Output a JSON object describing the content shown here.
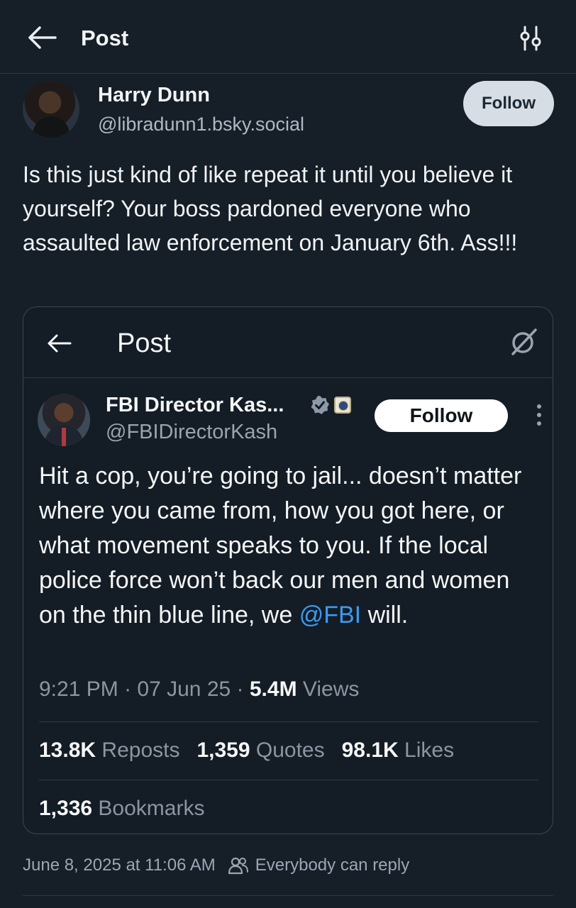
{
  "header": {
    "title": "Post",
    "back_icon": "arrow-left-icon",
    "filter_icon": "sliders-icon"
  },
  "post": {
    "author_name": "Harry Dunn",
    "author_handle": "@libradunn1.bsky.social",
    "follow_label": "Follow",
    "text": "Is this just kind of like repeat it until you believe it yourself? Your boss pardoned everyone who assaulted law enforcement on January 6th. Ass!!!",
    "timestamp": "June 8, 2025 at 11:06 AM",
    "reply_setting": "Everybody can reply"
  },
  "quoted": {
    "header_title": "Post",
    "author_name": "FBI Director Kas...",
    "author_handle": "@FBIDirectorKash",
    "follow_label": "Follow",
    "text_before": "Hit a cop, you’re going to jail... doesn’t matter where  you came from, how you got here, or what movement speaks to you. If the local police force won’t back our men and women on the thin blue line, we ",
    "mention": "@FBI",
    "text_after": " will.",
    "time": "9:21 PM",
    "date": "07 Jun 25",
    "views_count": "5.4M",
    "views_label": "Views",
    "reposts_count": "13.8K",
    "reposts_label": "Reposts",
    "quotes_count": "1,359",
    "quotes_label": "Quotes",
    "likes_count": "98.1K",
    "likes_label": "Likes",
    "bookmarks_count": "1,336",
    "bookmarks_label": "Bookmarks"
  },
  "colors": {
    "background": "#161e27",
    "link": "#3b9af0",
    "muted": "#8b96a2"
  }
}
